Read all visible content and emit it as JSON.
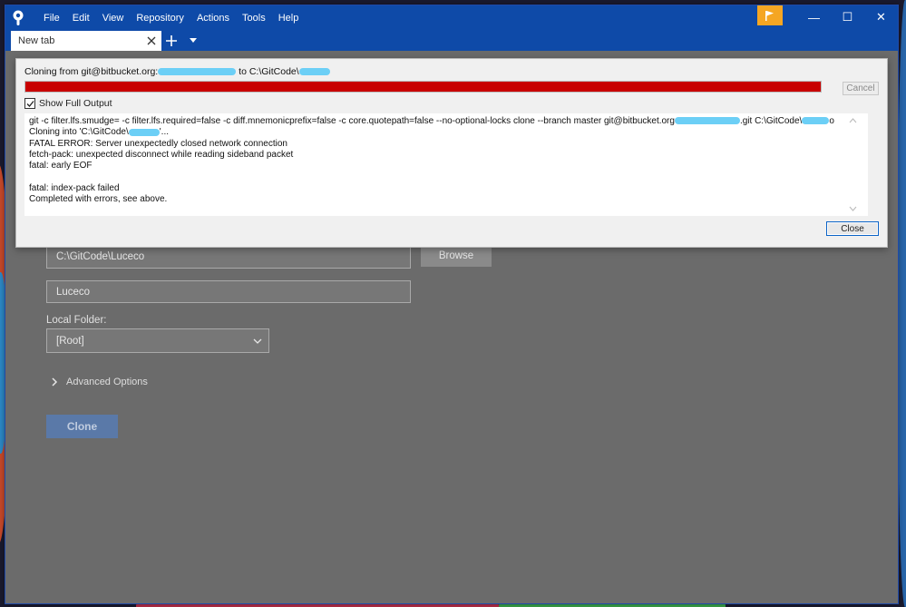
{
  "titlebar": {
    "logo_icon": "sourcetree-logo-icon",
    "menu": [
      "File",
      "Edit",
      "View",
      "Repository",
      "Actions",
      "Tools",
      "Help"
    ],
    "flag_icon": "flag-icon",
    "flag_color": "#f5a623",
    "minimize": "—",
    "maximize": "☐",
    "close": "✕",
    "bar_color": "#0e4aa8"
  },
  "tabs": {
    "active_label": "New tab",
    "add_icon": "plus-icon",
    "menu_icon": "chevron-down-icon"
  },
  "form": {
    "destination_path": "C:\\GitCode\\Luceco",
    "browse_label": "Browse",
    "name_value": "Luceco",
    "local_folder_label": "Local Folder:",
    "local_folder_value": "[Root]",
    "advanced_label": "Advanced Options",
    "clone_label": "Clone"
  },
  "dialog": {
    "status_prefix": "Cloning from git@bitbucket.org:",
    "status_mid": " to C:\\GitCode\\",
    "progress_percent": 100,
    "progress_color": "#c80000",
    "cancel_label": "Cancel",
    "show_output_label": "Show Full Output",
    "show_output_checked": true,
    "output_lines": [
      "git -c filter.lfs.smudge= -c filter.lfs.required=false -c diff.mnemonicprefix=false -c core.quotepath=false --no-optional-locks clone --branch master git@bitbucket.org",
      "Cloning into 'C:\\GitCode\\",
      "FATAL ERROR: Server unexpectedly closed network connection",
      "fetch-pack: unexpected disconnect while reading sideband packet",
      "fatal: early EOF",
      "",
      "fatal: index-pack failed",
      "Completed with errors, see above."
    ],
    "output_line0_tail": ".git C:\\GitCode\\",
    "output_line0_end": "o",
    "output_line1_tail": "'...",
    "close_label": "Close"
  }
}
